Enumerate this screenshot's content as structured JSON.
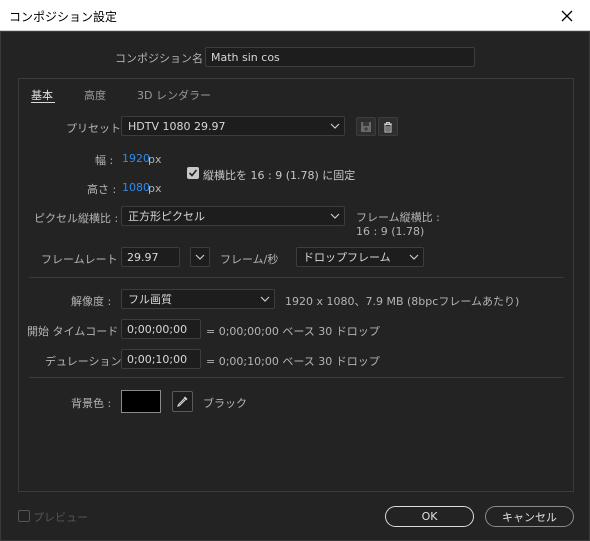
{
  "window": {
    "title": "コンポジション設定"
  },
  "comp_name": {
    "label": "コンポジション名 :",
    "value": "Math sin cos"
  },
  "tabs": [
    {
      "label": "基本"
    },
    {
      "label": "高度"
    },
    {
      "label": "3D レンダラー"
    }
  ],
  "preset": {
    "label": "プリセット :",
    "value": "HDTV 1080 29.97"
  },
  "width": {
    "label": "幅 :",
    "value": "1920",
    "unit": "px"
  },
  "height": {
    "label": "高さ :",
    "value": "1080",
    "unit": "px"
  },
  "lock_aspect": {
    "label": "縦横比を 16 : 9 (1.78) に固定",
    "checked": true
  },
  "pixel_aspect": {
    "label": "ピクセル縦横比 :",
    "value": "正方形ピクセル"
  },
  "frame_aspect": {
    "label": "フレーム縦横比 :",
    "value": "16 : 9 (1.78)"
  },
  "frame_rate": {
    "label": "フレームレート :",
    "value": "29.97",
    "unit_label": "フレーム/秒",
    "dropframe": "ドロップフレーム"
  },
  "resolution": {
    "label": "解像度 :",
    "value": "フル画質",
    "info": "1920 x 1080、7.9 MB (8bpcフレームあたり)"
  },
  "start_timecode": {
    "label": "開始 タイムコード :",
    "value": "0;00;00;00",
    "info": "= 0;00;00;00  ベース 30  ドロップ"
  },
  "duration": {
    "label": "デュレーション :",
    "value": "0;00;10;00",
    "info": "= 0;00;10;00  ベース 30  ドロップ"
  },
  "background": {
    "label": "背景色 :",
    "color": "#000000",
    "name": "ブラック"
  },
  "preview": {
    "label": "プレビュー",
    "checked": false
  },
  "buttons": {
    "ok": "OK",
    "cancel": "キャンセル"
  },
  "colors": {
    "accent": "#2d8ceb",
    "bg": "#232323"
  }
}
